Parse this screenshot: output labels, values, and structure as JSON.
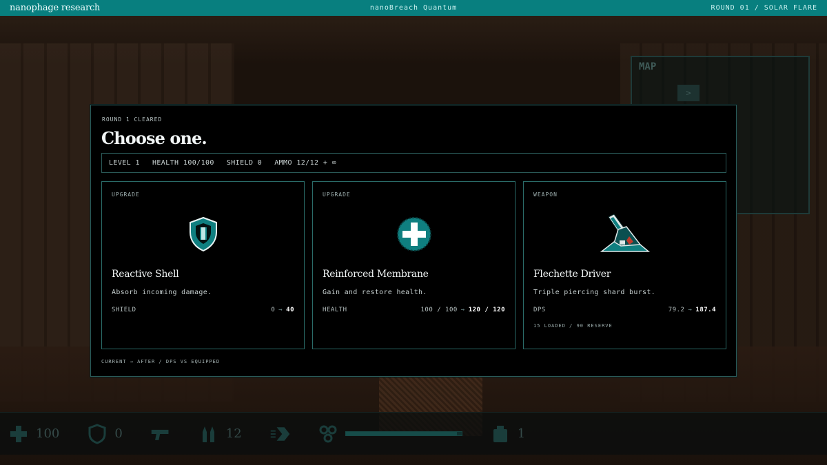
{
  "topbar": {
    "brand": "nanophage research",
    "game_title": "nanoBreach Quantum",
    "round_label": "ROUND 01 / SOLAR FLARE"
  },
  "background": {
    "map_title": "MAP",
    "map_marker": ">"
  },
  "hud": {
    "health_value": "100",
    "shield_value": "0",
    "ammo_value": "12",
    "items_value": "1"
  },
  "modal": {
    "eyebrow": "ROUND 1 CLEARED",
    "title": "Choose one.",
    "stats": {
      "level": "LEVEL 1",
      "health": "HEALTH 100/100",
      "shield": "SHIELD 0",
      "ammo": "AMMO 12/12 + ∞"
    },
    "cards": [
      {
        "kind": "UPGRADE",
        "icon": "shield-icon",
        "name": "Reactive Shell",
        "desc": "Absorb incoming damage.",
        "stat_label": "SHIELD",
        "current": "0",
        "arrow": "→",
        "after": "40"
      },
      {
        "kind": "UPGRADE",
        "icon": "health-cross-icon",
        "name": "Reinforced Membrane",
        "desc": "Gain and restore health.",
        "stat_label": "HEALTH",
        "current": "100 / 100",
        "arrow": "→",
        "after": "120 / 120"
      },
      {
        "kind": "WEAPON",
        "icon": "flechette-gun-icon",
        "name": "Flechette Driver",
        "desc": "Triple piercing shard burst.",
        "stat_label": "DPS",
        "current": "79.2",
        "arrow": "→",
        "after": "187.4",
        "sub": "15 LOADED / 90 RESERVE"
      }
    ],
    "footnote": "CURRENT → AFTER / DPS VS EQUIPPED"
  },
  "colors": {
    "accent": "#087f7f",
    "card_border": "#2a6b68",
    "icon_teal": "#0f7f80"
  }
}
